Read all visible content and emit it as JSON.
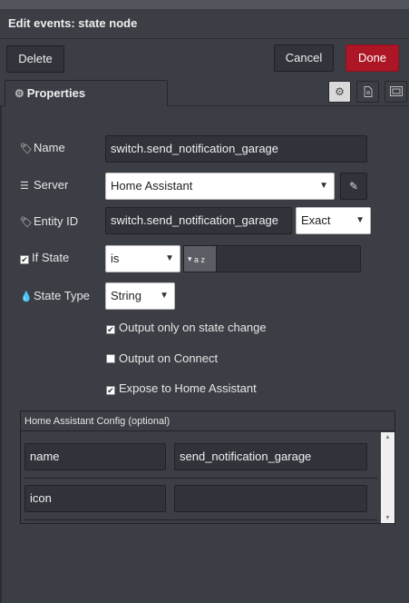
{
  "dialog": {
    "title": "Edit events: state node"
  },
  "toolbar": {
    "delete_label": "Delete",
    "cancel_label": "Cancel",
    "done_label": "Done"
  },
  "tabs": {
    "properties_label": "Properties"
  },
  "form": {
    "name": {
      "label": "Name",
      "value": "switch.send_notification_garage"
    },
    "server": {
      "label": "Server",
      "value": "Home Assistant"
    },
    "entity_id": {
      "label": "Entity ID",
      "value": "switch.send_notification_garage",
      "match": "Exact"
    },
    "if_state": {
      "label": "If State",
      "operator": "is",
      "type_glyph": "a z",
      "value": ""
    },
    "state_type": {
      "label": "State Type",
      "value": "String"
    },
    "options": {
      "output_on_change": {
        "label": "Output only on state change",
        "checked": true
      },
      "output_on_connect": {
        "label": "Output on Connect",
        "checked": false
      },
      "expose": {
        "label": "Expose to Home Assistant",
        "checked": true
      }
    }
  },
  "config": {
    "title": "Home Assistant Config (optional)",
    "rows": [
      {
        "key": "name",
        "value": "send_notification_garage"
      },
      {
        "key": "icon",
        "value": ""
      }
    ]
  },
  "colors": {
    "background": "#3b3e44",
    "primary_button": "#ad1625",
    "field": "#30333a"
  },
  "icons": {
    "properties_tab": "gear-icon",
    "description_tab": "document-icon",
    "appearance_tab": "frame-icon",
    "name": "tag-icon",
    "server": "server-icon",
    "entity": "tag-icon",
    "if_state": "checkbox-icon",
    "state_type": "drop-icon",
    "edit_server": "pencil-icon"
  }
}
